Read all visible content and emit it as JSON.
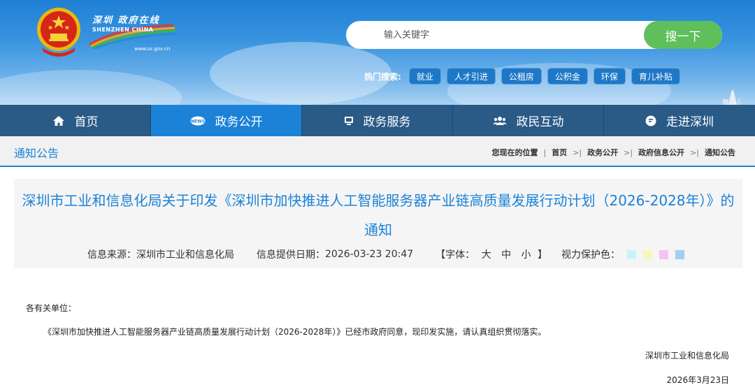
{
  "header": {
    "logo_cn": "深圳 政府在线",
    "logo_en": "SHENZHEN CHINA",
    "logo_url": "www.sz.gov.cn",
    "search_placeholder": "输入关键字",
    "search_button": "搜一下",
    "hot_label": "热门搜索:",
    "hot_tags": [
      "就业",
      "人才引进",
      "公租房",
      "公积金",
      "环保",
      "育儿补贴"
    ]
  },
  "nav": {
    "items": [
      {
        "label": "首页",
        "icon": "home-icon"
      },
      {
        "label": "政务公开",
        "icon": "news-icon"
      },
      {
        "label": "政务服务",
        "icon": "monitor-icon"
      },
      {
        "label": "政民互动",
        "icon": "users-icon"
      },
      {
        "label": "走进深圳",
        "icon": "chat-icon"
      }
    ],
    "active_index": 1
  },
  "breadcrumb": {
    "section_title": "通知公告",
    "prefix": "您现在的位置",
    "items": [
      "首页",
      "政务公开",
      "政府信息公开",
      "通知公告"
    ],
    "separator": ">"
  },
  "article": {
    "title_line1": "深圳市工业和信息化局关于印发《深圳市加快推进人工智能服务器产业链高质量发展行动计划（2026-2028年）》的",
    "title_line2": "通知",
    "source_label": "信息来源：",
    "source": "深圳市工业和信息化局",
    "date_label": "信息提供日期：",
    "date": "2026-03-23 20:47",
    "font_label": "【字体：",
    "font_sizes": [
      "大",
      "中",
      "小"
    ],
    "font_end": "】",
    "eye_label": "视力保护色：",
    "eye_colors": [
      "#c9f3fb",
      "#f7f6bb",
      "#f6c3f1",
      "#a4cdf7"
    ],
    "salutation": "各有关单位：",
    "paragraph": "《深圳市加快推进人工智能服务器产业链高质量发展行动计划（2026-2028年）》已经市政府同意，现印发实施，请认真组织贯彻落实。",
    "signature": "深圳市工业和信息化局",
    "signed_date": "2026年3月23日"
  },
  "colors": {
    "accent": "#1b82d8",
    "nav_bg": "#2a5a86",
    "search_button": "#5fbf5a"
  }
}
